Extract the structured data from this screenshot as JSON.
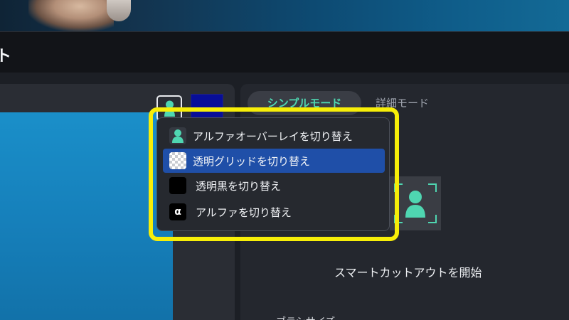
{
  "window": {
    "title_fragment": "ト"
  },
  "tabs": {
    "simple_label": "シンプルモード",
    "detail_label": "詳細モード"
  },
  "context_menu": {
    "items": [
      {
        "label": "アルファオーバーレイを切り替え",
        "icon": "person-overlay-icon",
        "selected": false
      },
      {
        "label": "透明グリッドを切り替え",
        "icon": "checkerboard-icon",
        "selected": true
      },
      {
        "label": "透明黒を切り替え",
        "icon": "black-square-icon",
        "selected": false
      },
      {
        "label": "アルファを切り替え",
        "icon": "alpha-icon",
        "glyph": "α",
        "selected": false
      }
    ]
  },
  "main": {
    "smart_cut_label": "スマートカットアウトを開始",
    "brush_size_label": "ブラシサイズ"
  },
  "colors": {
    "accent": "#4fd6b1",
    "highlight": "#f7ee08",
    "selection": "#1f4fa8",
    "swatch": "#080e98"
  }
}
